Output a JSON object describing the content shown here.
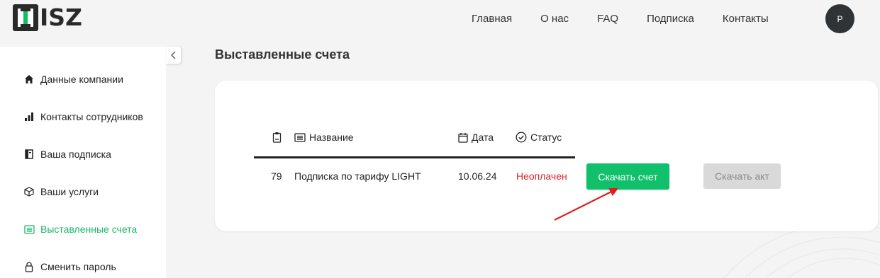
{
  "logo": {
    "text": "ISZ"
  },
  "nav": {
    "items": [
      "Главная",
      "О нас",
      "FAQ",
      "Подписка",
      "Контакты"
    ]
  },
  "user": {
    "avatar_initial": "P"
  },
  "sidebar": {
    "items": [
      {
        "label": "Данные компании",
        "icon": "home-icon"
      },
      {
        "label": "Контакты сотрудников",
        "icon": "bar-chart-icon"
      },
      {
        "label": "Ваша подписка",
        "icon": "book-icon"
      },
      {
        "label": "Ваши услуги",
        "icon": "cube-icon"
      },
      {
        "label": "Выставленные счета",
        "icon": "invoice-icon",
        "active": true
      },
      {
        "label": "Сменить пароль",
        "icon": "lock-icon"
      }
    ]
  },
  "page": {
    "title": "Выставленные счета"
  },
  "table": {
    "headers": {
      "name": "Название",
      "date": "Дата",
      "status": "Статус"
    },
    "rows": [
      {
        "number": "79",
        "name": "Подписка по тарифу LIGHT",
        "date": "10.06.24",
        "status": "Неоплачен"
      }
    ],
    "download_invoice_label": "Скачать счет",
    "download_act_label": "Скачать акт"
  },
  "colors": {
    "accent": "#10c06a",
    "status_unpaid": "#d9262b",
    "annotation_arrow": "#e02020"
  }
}
